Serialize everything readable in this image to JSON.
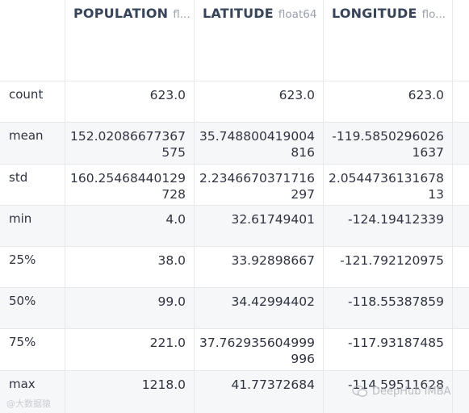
{
  "columns": [
    {
      "name": "POPULATION",
      "dtype": "fl..."
    },
    {
      "name": "LATITUDE",
      "dtype": "float64"
    },
    {
      "name": "LONGITUDE",
      "dtype": "flo..."
    }
  ],
  "rows": [
    {
      "label": "count",
      "values": [
        "623.0",
        "623.0",
        "623.0"
      ]
    },
    {
      "label": "mean",
      "values": [
        "152.02086677367575",
        "35.748800419004816",
        "-119.58502960261637"
      ]
    },
    {
      "label": "std",
      "values": [
        "160.25468440129728",
        "2.2346670371716297",
        "2.054473613167813"
      ]
    },
    {
      "label": "min",
      "values": [
        "4.0",
        "32.61749401",
        "-124.19412339"
      ]
    },
    {
      "label": "25%",
      "values": [
        "38.0",
        "33.92898667",
        "-121.792120975"
      ]
    },
    {
      "label": "50%",
      "values": [
        "99.0",
        "34.42994402",
        "-118.55387859"
      ]
    },
    {
      "label": "75%",
      "values": [
        "221.0",
        "37.762935604999996",
        "-117.93187485"
      ]
    },
    {
      "label": "max",
      "values": [
        "1218.0",
        "41.77372684",
        "-114.59511628"
      ]
    }
  ],
  "watermark": {
    "left": "@大数据猿",
    "right": "DeepHub IMBA"
  }
}
